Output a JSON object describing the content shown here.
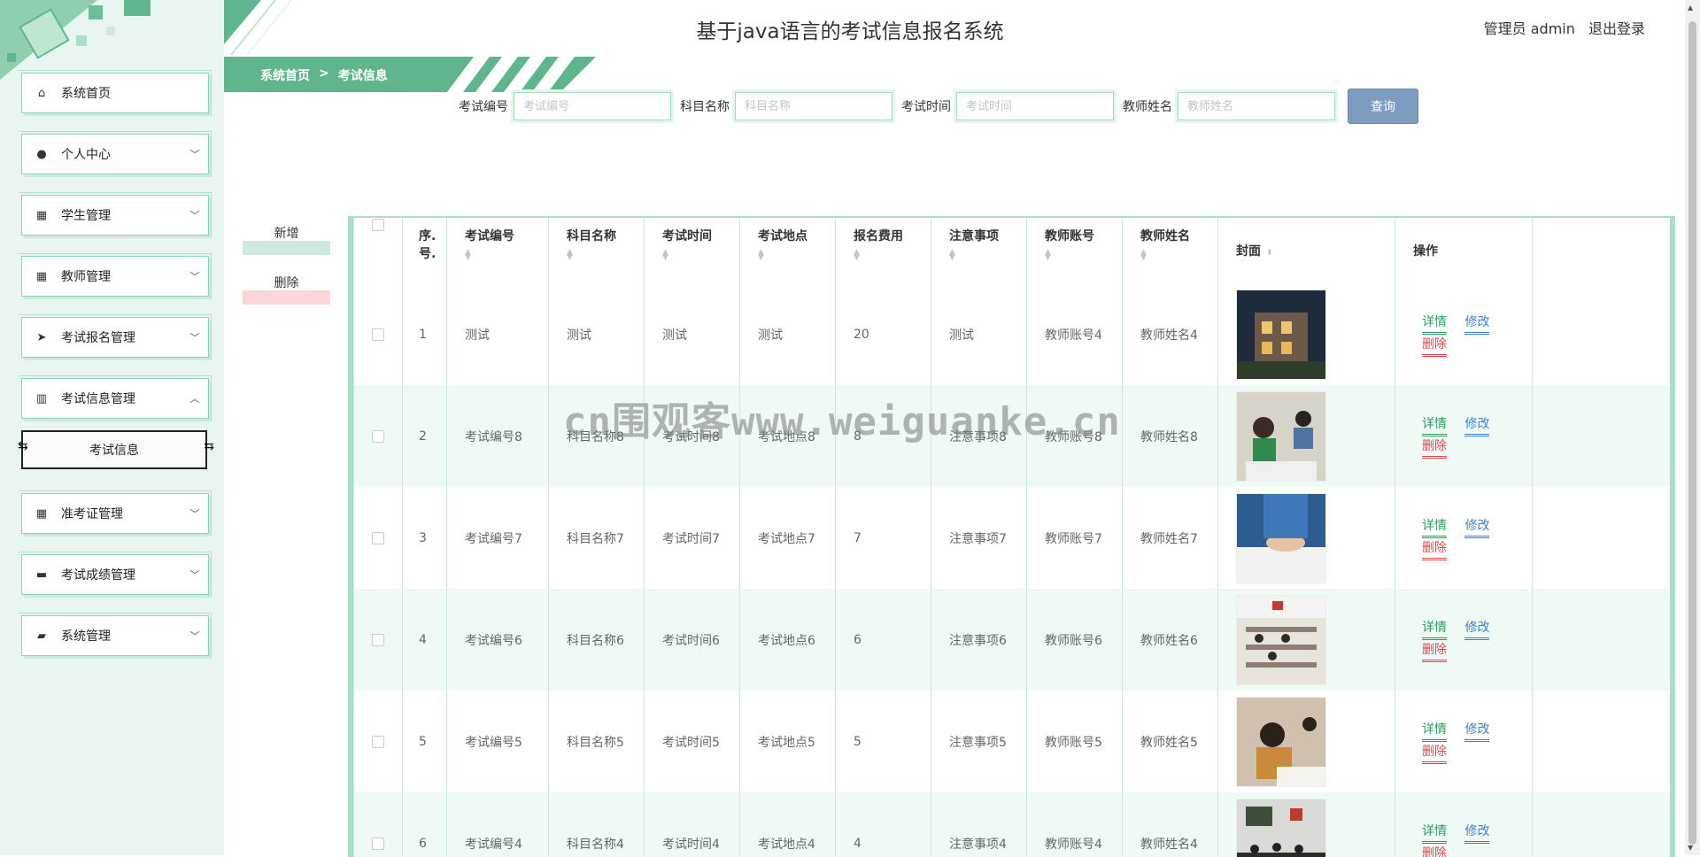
{
  "header": {
    "title": "基于java语言的考试信息报名系统",
    "user": "管理员 admin",
    "logout": "退出登录"
  },
  "breadcrumb": {
    "home": "系统首页",
    "sep": ">",
    "current": "考试信息"
  },
  "sidebar": {
    "items": [
      {
        "label": "系统首页",
        "icon": "home-icon",
        "arrow": ""
      },
      {
        "label": "个人中心",
        "icon": "user-icon",
        "arrow": "﹀"
      },
      {
        "label": "学生管理",
        "icon": "grid-icon",
        "arrow": "﹀"
      },
      {
        "label": "教师管理",
        "icon": "grid-icon",
        "arrow": "﹀"
      },
      {
        "label": "考试报名管理",
        "icon": "send-icon",
        "arrow": "﹀"
      },
      {
        "label": "考试信息管理",
        "icon": "library-icon",
        "arrow": "︿"
      }
    ],
    "sub_item": "考试信息",
    "items_after": [
      {
        "label": "准考证管理",
        "icon": "grid-icon",
        "arrow": "﹀"
      },
      {
        "label": "考试成绩管理",
        "icon": "chat-icon",
        "arrow": "﹀"
      },
      {
        "label": "系统管理",
        "icon": "wallet-icon",
        "arrow": "﹀"
      }
    ]
  },
  "search": {
    "fields": [
      {
        "label": "考试编号",
        "placeholder": "考试编号",
        "value": ""
      },
      {
        "label": "科目名称",
        "placeholder": "科目名称",
        "value": ""
      },
      {
        "label": "考试时间",
        "placeholder": "考试时间",
        "value": ""
      },
      {
        "label": "教师姓名",
        "placeholder": "教师姓名",
        "value": ""
      }
    ],
    "button": "查询"
  },
  "actions": {
    "add": "新增",
    "delete": "删除"
  },
  "table": {
    "columns": [
      "序.号.",
      "考试编号",
      "科目名称",
      "考试时间",
      "考试地点",
      "报名费用",
      "注意事项",
      "教师账号",
      "教师姓名",
      "封面",
      "操作"
    ],
    "op_labels": {
      "detail": "详情",
      "edit": "修改",
      "delete": "删除"
    },
    "rows": [
      {
        "idx": "1",
        "code": "测试",
        "subject": "测试",
        "time": "测试",
        "place": "测试",
        "fee": "20",
        "notes": "测试",
        "teacher_account": "教师账号4",
        "teacher_name": "教师姓名4",
        "cover": "night-building-photo"
      },
      {
        "idx": "2",
        "code": "考试编号8",
        "subject": "科目名称8",
        "time": "考试时间8",
        "place": "考试地点8",
        "fee": "8",
        "notes": "注意事项8",
        "teacher_account": "教师账号8",
        "teacher_name": "教师姓名8",
        "cover": "students-exam-photo"
      },
      {
        "idx": "3",
        "code": "考试编号7",
        "subject": "科目名称7",
        "time": "考试时间7",
        "place": "考试地点7",
        "fee": "7",
        "notes": "注意事项7",
        "teacher_account": "教师账号7",
        "teacher_name": "教师姓名7",
        "cover": "writing-hand-photo"
      },
      {
        "idx": "4",
        "code": "考试编号6",
        "subject": "科目名称6",
        "time": "考试时间6",
        "place": "考试地点6",
        "fee": "6",
        "notes": "注意事项6",
        "teacher_account": "教师账号6",
        "teacher_name": "教师姓名6",
        "cover": "exam-hall-photo"
      },
      {
        "idx": "5",
        "code": "考试编号5",
        "subject": "科目名称5",
        "time": "考试时间5",
        "place": "考试地点5",
        "fee": "5",
        "notes": "注意事项5",
        "teacher_account": "教师账号5",
        "teacher_name": "教师姓名5",
        "cover": "student-desk-photo"
      },
      {
        "idx": "6",
        "code": "考试编号4",
        "subject": "科目名称4",
        "time": "考试时间4",
        "place": "考试地点4",
        "fee": "4",
        "notes": "注意事项4",
        "teacher_account": "教师账号4",
        "teacher_name": "教师姓名4",
        "cover": "classroom-photo"
      }
    ]
  },
  "watermark": "cn围观客www.weiguanke.cn",
  "colors": {
    "accent": "#5fb58c",
    "sidebar_bg": "#e8f6ef",
    "query": "#7d9cbf",
    "detail": "#2e9b5f",
    "edit": "#3b82d6",
    "delete": "#e0444c"
  }
}
